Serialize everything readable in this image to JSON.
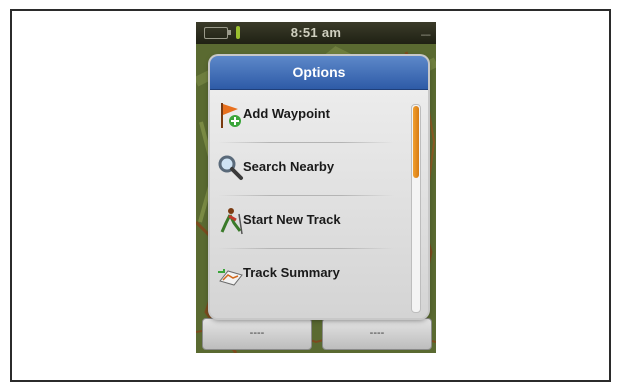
{
  "status_bar": {
    "time": "8:51 am",
    "signal_indicator": "----",
    "icons": [
      "battery-icon",
      "gps-icon"
    ]
  },
  "options_menu": {
    "title": "Options",
    "items": [
      {
        "label": "Add Waypoint",
        "icon": "flag-plus-icon"
      },
      {
        "label": "Search Nearby",
        "icon": "magnifier-icon"
      },
      {
        "label": "Start New Track",
        "icon": "hiker-icon"
      },
      {
        "label": "Track Summary",
        "icon": "track-summary-icon"
      }
    ]
  },
  "bottom_buttons": [
    {
      "label": "----"
    },
    {
      "label": "----"
    }
  ],
  "colors": {
    "title_bar": "#3b67b3",
    "scroll_thumb": "#e08a1e",
    "map_green": "#5e6e34"
  }
}
